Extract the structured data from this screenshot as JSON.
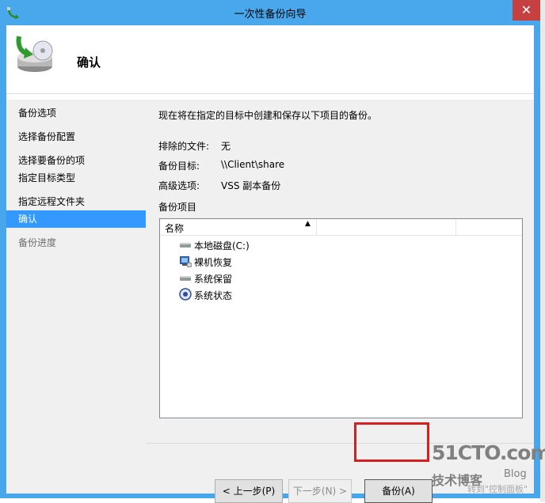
{
  "window": {
    "title": "一次性备份向导",
    "close_glyph": "✕"
  },
  "header": {
    "title": "确认"
  },
  "sidebar": {
    "items": [
      {
        "label": "备份选项",
        "state": "normal"
      },
      {
        "label": "选择备份配置",
        "state": "normal"
      },
      {
        "label": "选择要备份的项",
        "label2": "指定目标类型",
        "state": "normal"
      },
      {
        "label": "指定远程文件夹",
        "state": "normal"
      },
      {
        "label": "确认",
        "state": "active"
      },
      {
        "label": "备份进度",
        "state": "muted"
      }
    ]
  },
  "content": {
    "intro": "现在将在指定的目标中创建和保存以下项目的备份。",
    "excluded_label": "排除的文件:",
    "excluded_value": "无",
    "target_label": "备份目标:",
    "target_value": "\\\\Client\\share",
    "advanced_label": "高级选项:",
    "advanced_value": "VSS 副本备份",
    "items_label": "备份项目",
    "list": {
      "column_header": "名称",
      "items": [
        {
          "label": "本地磁盘(C:)",
          "icon": "disk-icon"
        },
        {
          "label": "裸机恢复",
          "icon": "bare-metal-icon"
        },
        {
          "label": "系统保留",
          "icon": "disk-icon"
        },
        {
          "label": "系统状态",
          "icon": "system-state-icon"
        }
      ]
    }
  },
  "buttons": {
    "back": "< 上一步(P)",
    "next": "下一步(N) >",
    "backup": "备份(A)"
  },
  "watermark": {
    "site": "51CTO.com",
    "blog_cn": "技术博客",
    "blog_en": "Blog",
    "activate": "转到\"控制面板\""
  },
  "colors": {
    "titlebar": "#48a8eb",
    "selection": "#3399ff",
    "close": "#c74040",
    "highlight_box": "#d62020"
  }
}
